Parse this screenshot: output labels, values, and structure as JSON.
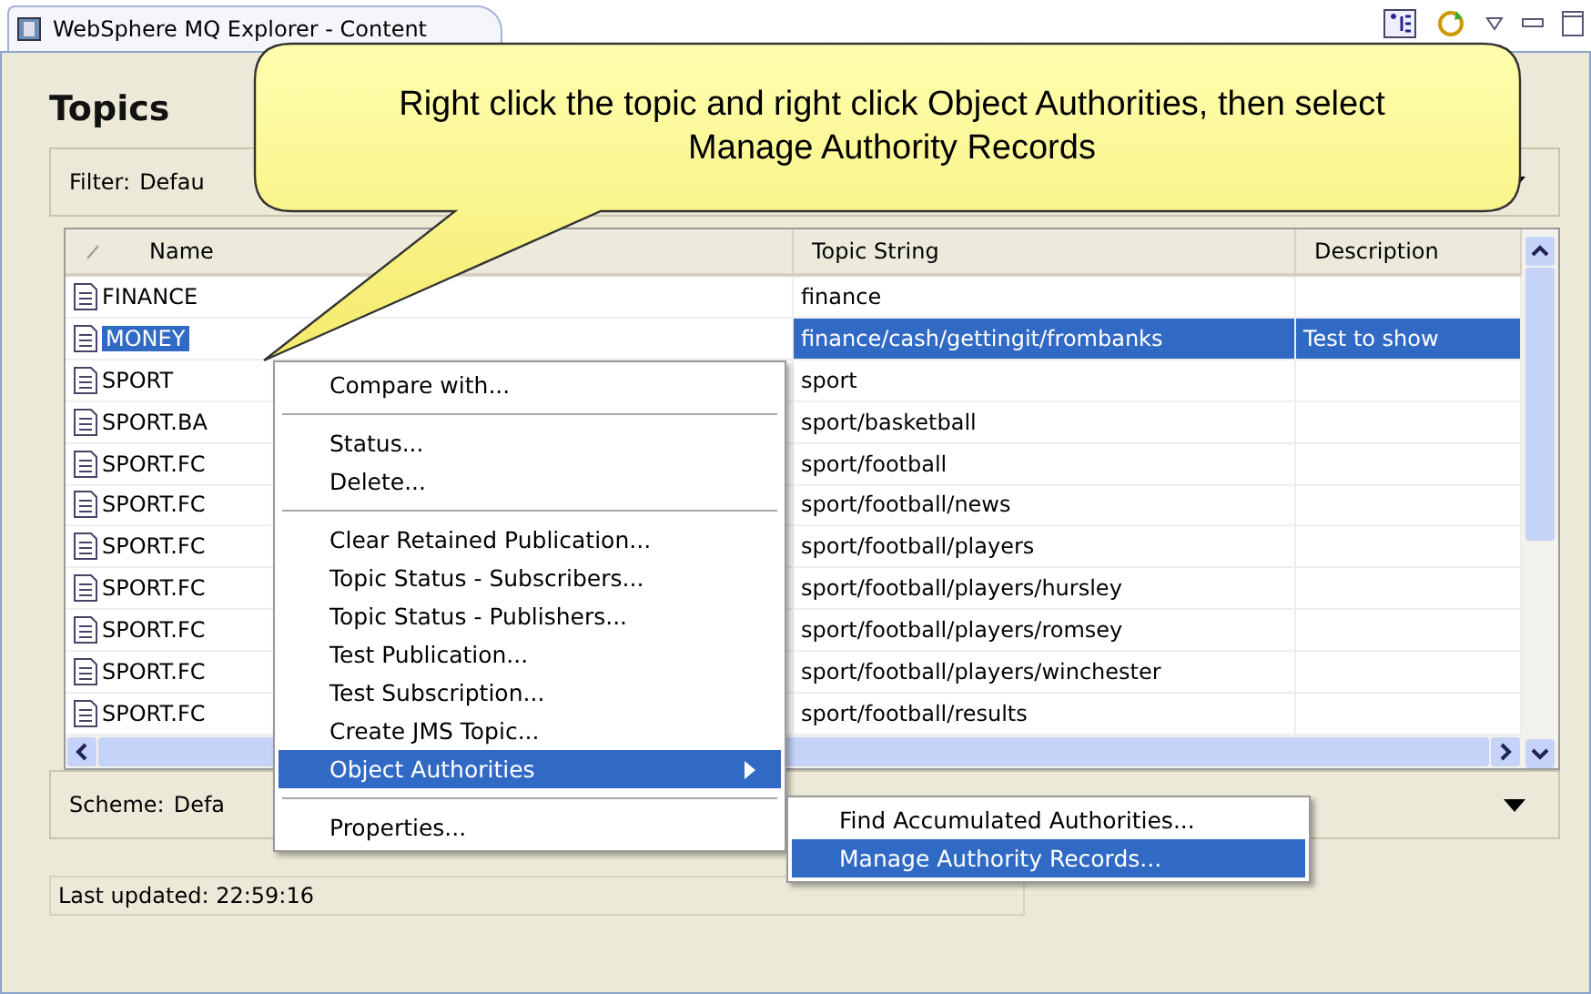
{
  "window": {
    "title": "WebSphere MQ Explorer - Content"
  },
  "panel": {
    "title": "Topics",
    "filter": {
      "label": "Filter:",
      "value": "Defau"
    },
    "scheme": {
      "label": "Scheme:",
      "value": "Defa"
    },
    "status": "Last updated: 22:59:16"
  },
  "table": {
    "columns": [
      "Name",
      "Topic String",
      "Description"
    ],
    "rows": [
      {
        "cells": [
          "FINANCE",
          "finance",
          ""
        ],
        "selected": false
      },
      {
        "cells": [
          "MONEY",
          "finance/cash/gettingit/frombanks",
          "Test to show"
        ],
        "selected": true
      },
      {
        "cells": [
          "SPORT",
          "sport",
          ""
        ],
        "selected": false
      },
      {
        "cells": [
          "SPORT.BA",
          "sport/basketball",
          ""
        ],
        "selected": false
      },
      {
        "cells": [
          "SPORT.FC",
          "sport/football",
          ""
        ],
        "selected": false
      },
      {
        "cells": [
          "SPORT.FC",
          "sport/football/news",
          ""
        ],
        "selected": false
      },
      {
        "cells": [
          "SPORT.FC",
          "sport/football/players",
          ""
        ],
        "selected": false
      },
      {
        "cells": [
          "SPORT.FC",
          "sport/football/players/hursley",
          ""
        ],
        "selected": false
      },
      {
        "cells": [
          "SPORT.FC",
          "sport/football/players/romsey",
          ""
        ],
        "selected": false
      },
      {
        "cells": [
          "SPORT.FC",
          "sport/football/players/winchester",
          ""
        ],
        "selected": false
      },
      {
        "cells": [
          "SPORT.FC",
          "sport/football/results",
          ""
        ],
        "selected": false
      }
    ]
  },
  "context_menu": {
    "items": [
      {
        "kind": "item",
        "label": "Compare with...",
        "selected": false
      },
      {
        "kind": "separator"
      },
      {
        "kind": "item",
        "label": "Status...",
        "selected": false
      },
      {
        "kind": "item",
        "label": "Delete...",
        "selected": false
      },
      {
        "kind": "separator"
      },
      {
        "kind": "item",
        "label": "Clear Retained Publication...",
        "selected": false
      },
      {
        "kind": "item",
        "label": "Topic Status - Subscribers...",
        "selected": false
      },
      {
        "kind": "item",
        "label": "Topic Status - Publishers...",
        "selected": false
      },
      {
        "kind": "item",
        "label": "Test Publication...",
        "selected": false
      },
      {
        "kind": "item",
        "label": "Test Subscription...",
        "selected": false
      },
      {
        "kind": "item",
        "label": "Create JMS Topic...",
        "selected": false
      },
      {
        "kind": "submenu",
        "label": "Object Authorities",
        "selected": true
      },
      {
        "kind": "separator"
      },
      {
        "kind": "item",
        "label": "Properties...",
        "selected": false
      }
    ]
  },
  "submenu": {
    "items": [
      {
        "label": "Find Accumulated Authorities...",
        "selected": false
      },
      {
        "label": "Manage Authority Records...",
        "selected": true
      }
    ]
  },
  "callout": {
    "text": "Right click the topic and right click Object Authorities, then select Manage Authority Records"
  }
}
